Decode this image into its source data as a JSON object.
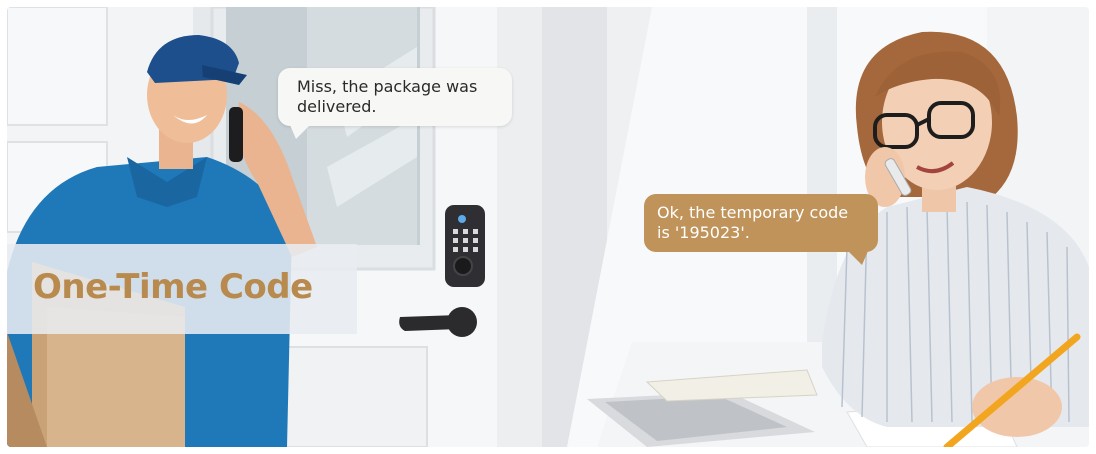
{
  "banner": {
    "title": "One-Time Code",
    "bubble_courier": "Miss, the package was delivered.",
    "bubble_resident": "Ok, the temporary code is '195023'."
  },
  "colors": {
    "accent_gold": "#bf9359",
    "title_gold": "#b98a4e",
    "courier_uniform": "#1f78b8",
    "lock_body": "#2f2f33"
  },
  "scene": {
    "left_person": "delivery courier on phone holding box",
    "right_person": "woman with glasses on phone writing",
    "device": "keypad-smart-lock"
  }
}
